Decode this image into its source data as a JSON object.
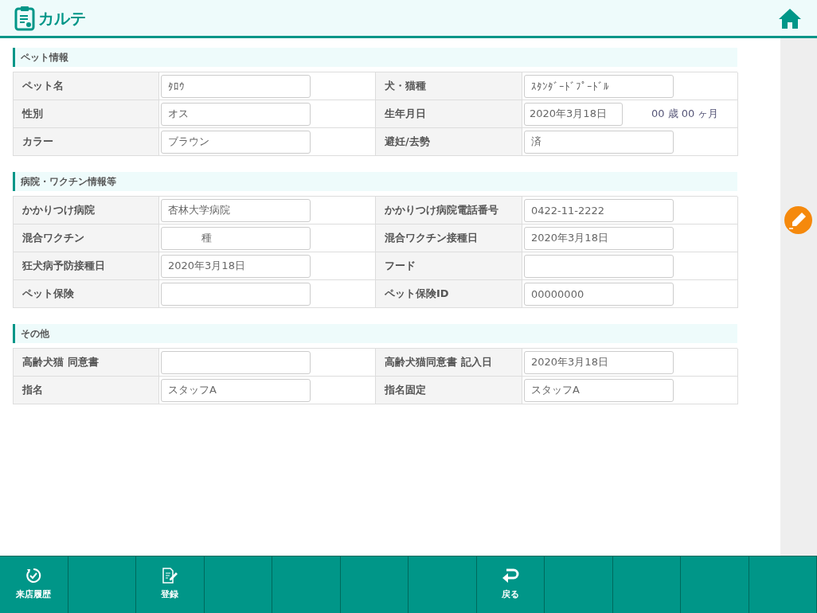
{
  "header": {
    "title": "カルテ"
  },
  "sections": [
    {
      "title": "ペット情報",
      "rows": [
        [
          {
            "label": "ペット名",
            "value": "ﾀﾛｳ"
          },
          {
            "label": "犬・猫種",
            "value": "ｽﾀﾝﾀﾞｰﾄﾞﾌﾟｰﾄﾞﾙ"
          }
        ],
        [
          {
            "label": "性別",
            "value": "オス"
          },
          {
            "label": "生年月日",
            "value": "2020年3月18日",
            "kind": "date_age",
            "age": "00 歳 00 ヶ月"
          }
        ],
        [
          {
            "label": "カラー",
            "value": "ブラウン"
          },
          {
            "label": "避妊/去勢",
            "value": "済"
          }
        ]
      ]
    },
    {
      "title": "病院・ワクチン情報等",
      "rows": [
        [
          {
            "label": "かかりつけ病院",
            "value": "杏林大学病院"
          },
          {
            "label": "かかりつけ病院電話番号",
            "value": "0422-11-2222"
          }
        ],
        [
          {
            "label": "混合ワクチン",
            "value": "種",
            "kind": "count"
          },
          {
            "label": "混合ワクチン接種日",
            "value": "2020年3月18日"
          }
        ],
        [
          {
            "label": "狂犬病予防接種日",
            "value": "2020年3月18日"
          },
          {
            "label": "フード"
          }
        ],
        [
          {
            "label": "ペット保険"
          },
          {
            "label": "ペット保険ID",
            "value": "00000000"
          }
        ]
      ]
    },
    {
      "title": "その他",
      "rows": [
        [
          {
            "label": "高齢犬猫 同意書"
          },
          {
            "label": "高齢犬猫同意書 記入日",
            "value": "2020年3月18日"
          }
        ],
        [
          {
            "label": "指名",
            "value": "スタッフA"
          },
          {
            "label": "指名固定",
            "value": "スタッフA"
          }
        ]
      ]
    }
  ],
  "footer_buttons": [
    {
      "kind": "history",
      "label": "来店履歴"
    },
    {
      "kind": "blank"
    },
    {
      "kind": "register",
      "label": "登録"
    },
    {
      "kind": "blank"
    },
    {
      "kind": "blank"
    },
    {
      "kind": "blank"
    },
    {
      "kind": "blank"
    },
    {
      "kind": "back",
      "label": "戻る"
    },
    {
      "kind": "blank"
    },
    {
      "kind": "blank"
    },
    {
      "kind": "blank"
    },
    {
      "kind": "blank"
    }
  ]
}
